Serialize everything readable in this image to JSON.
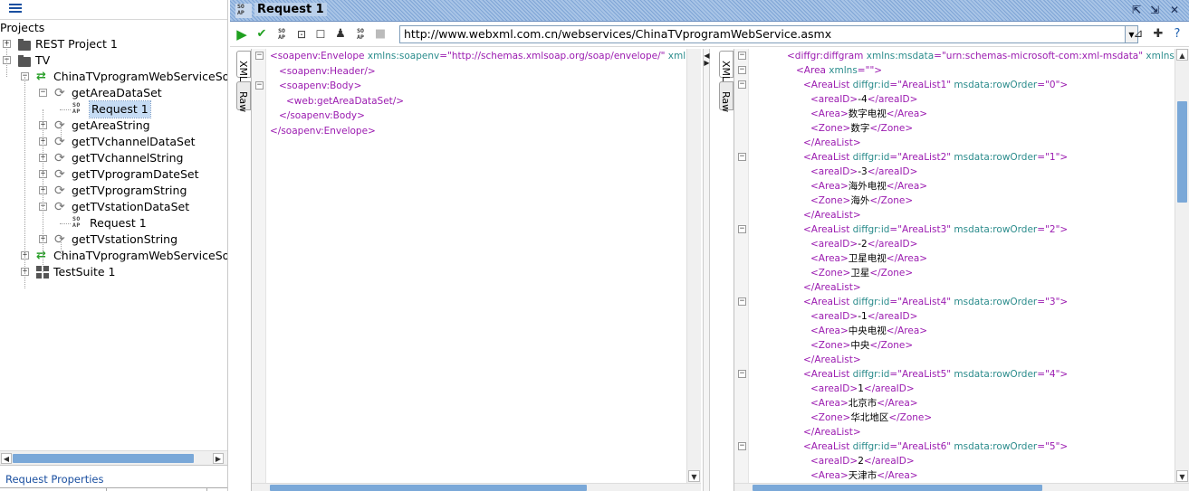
{
  "navigator": {
    "root_label": "Projects",
    "tree": [
      {
        "label": "REST Project 1",
        "icon": "folder-icon",
        "level": 0,
        "expander": "+"
      },
      {
        "label": "TV",
        "icon": "folder-icon",
        "level": 0,
        "expander": "-"
      },
      {
        "label": "ChinaTVprogramWebServiceSoa",
        "icon": "interface-icon",
        "level": 1,
        "expander": "-"
      },
      {
        "label": "getAreaDataSet",
        "icon": "operation-icon",
        "level": 2,
        "expander": "-"
      },
      {
        "label": "Request 1",
        "icon": "soap-request-icon",
        "level": 3,
        "expander": "",
        "selected": true
      },
      {
        "label": "getAreaString",
        "icon": "operation-icon",
        "level": 2,
        "expander": "+"
      },
      {
        "label": "getTVchannelDataSet",
        "icon": "operation-icon",
        "level": 2,
        "expander": "+"
      },
      {
        "label": "getTVchannelString",
        "icon": "operation-icon",
        "level": 2,
        "expander": "+"
      },
      {
        "label": "getTVprogramDateSet",
        "icon": "operation-icon",
        "level": 2,
        "expander": "+"
      },
      {
        "label": "getTVprogramString",
        "icon": "operation-icon",
        "level": 2,
        "expander": "+"
      },
      {
        "label": "getTVstationDataSet",
        "icon": "operation-icon",
        "level": 2,
        "expander": "-"
      },
      {
        "label": "Request 1",
        "icon": "soap-request-icon",
        "level": 3,
        "expander": ""
      },
      {
        "label": "getTVstationString",
        "icon": "operation-icon",
        "level": 2,
        "expander": "+"
      },
      {
        "label": "ChinaTVprogramWebServiceSoa",
        "icon": "interface-icon",
        "level": 1,
        "expander": "+"
      },
      {
        "label": "TestSuite 1",
        "icon": "test-suite-icon",
        "level": 1,
        "expander": "+"
      }
    ],
    "properties_title": "Request Properties"
  },
  "request_window": {
    "title": "Request 1",
    "endpoint": "http://www.webxml.com.cn/webservices/ChinaTVprogramWebService.asmx"
  },
  "tabs": {
    "xml": "XML",
    "raw": "Raw"
  },
  "request_xml": [
    [
      [
        "t",
        "<soapenv:Envelope"
      ],
      [
        "a",
        " xmlns:soapenv"
      ],
      [
        "t",
        "="
      ],
      [
        "v",
        "\"http://schemas.xmlsoap.org/soap/envelope/\""
      ],
      [
        "a",
        " xmlns:web"
      ],
      [
        "t",
        "=\""
      ]
    ],
    [
      [
        "t",
        "<soapenv:Header/>"
      ]
    ],
    [
      [
        "t",
        "<soapenv:Body>"
      ]
    ],
    [
      [
        "t",
        "<web:getAreaDataSet/>"
      ]
    ],
    [
      [
        "t",
        "</soapenv:Body>"
      ]
    ],
    [
      [
        "t",
        "</soapenv:Envelope>"
      ]
    ]
  ],
  "response_xml": [
    [
      [
        "t",
        "<diffgr:diffgram"
      ],
      [
        "a",
        " xmlns:msdata"
      ],
      [
        "t",
        "="
      ],
      [
        "v",
        "\"urn:schemas-microsoft-com:xml-msdata\""
      ],
      [
        "a",
        " xmlns:diffgr"
      ],
      [
        "t",
        "=\"u"
      ]
    ],
    [
      [
        "t",
        "<Area"
      ],
      [
        "a",
        " xmlns"
      ],
      [
        "t",
        "="
      ],
      [
        "v",
        "\"\""
      ],
      [
        "t",
        ">"
      ]
    ],
    [
      [
        "t",
        "<AreaList"
      ],
      [
        "a",
        " diffgr:id"
      ],
      [
        "t",
        "="
      ],
      [
        "v",
        "\"AreaList1\""
      ],
      [
        "a",
        " msdata:rowOrder"
      ],
      [
        "t",
        "="
      ],
      [
        "v",
        "\"0\""
      ],
      [
        "t",
        ">"
      ]
    ],
    [
      [
        "t",
        "<areaID>"
      ],
      [
        "x",
        "-4"
      ],
      [
        "t",
        "</areaID>"
      ]
    ],
    [
      [
        "t",
        "<Area>"
      ],
      [
        "x",
        "数字电视"
      ],
      [
        "t",
        "</Area>"
      ]
    ],
    [
      [
        "t",
        "<Zone>"
      ],
      [
        "x",
        "数字"
      ],
      [
        "t",
        "</Zone>"
      ]
    ],
    [
      [
        "t",
        "</AreaList>"
      ]
    ],
    [
      [
        "t",
        "<AreaList"
      ],
      [
        "a",
        " diffgr:id"
      ],
      [
        "t",
        "="
      ],
      [
        "v",
        "\"AreaList2\""
      ],
      [
        "a",
        " msdata:rowOrder"
      ],
      [
        "t",
        "="
      ],
      [
        "v",
        "\"1\""
      ],
      [
        "t",
        ">"
      ]
    ],
    [
      [
        "t",
        "<areaID>"
      ],
      [
        "x",
        "-3"
      ],
      [
        "t",
        "</areaID>"
      ]
    ],
    [
      [
        "t",
        "<Area>"
      ],
      [
        "x",
        "海外电视"
      ],
      [
        "t",
        "</Area>"
      ]
    ],
    [
      [
        "t",
        "<Zone>"
      ],
      [
        "x",
        "海外"
      ],
      [
        "t",
        "</Zone>"
      ]
    ],
    [
      [
        "t",
        "</AreaList>"
      ]
    ],
    [
      [
        "t",
        "<AreaList"
      ],
      [
        "a",
        " diffgr:id"
      ],
      [
        "t",
        "="
      ],
      [
        "v",
        "\"AreaList3\""
      ],
      [
        "a",
        " msdata:rowOrder"
      ],
      [
        "t",
        "="
      ],
      [
        "v",
        "\"2\""
      ],
      [
        "t",
        ">"
      ]
    ],
    [
      [
        "t",
        "<areaID>"
      ],
      [
        "x",
        "-2"
      ],
      [
        "t",
        "</areaID>"
      ]
    ],
    [
      [
        "t",
        "<Area>"
      ],
      [
        "x",
        "卫星电视"
      ],
      [
        "t",
        "</Area>"
      ]
    ],
    [
      [
        "t",
        "<Zone>"
      ],
      [
        "x",
        "卫星"
      ],
      [
        "t",
        "</Zone>"
      ]
    ],
    [
      [
        "t",
        "</AreaList>"
      ]
    ],
    [
      [
        "t",
        "<AreaList"
      ],
      [
        "a",
        " diffgr:id"
      ],
      [
        "t",
        "="
      ],
      [
        "v",
        "\"AreaList4\""
      ],
      [
        "a",
        " msdata:rowOrder"
      ],
      [
        "t",
        "="
      ],
      [
        "v",
        "\"3\""
      ],
      [
        "t",
        ">"
      ]
    ],
    [
      [
        "t",
        "<areaID>"
      ],
      [
        "x",
        "-1"
      ],
      [
        "t",
        "</areaID>"
      ]
    ],
    [
      [
        "t",
        "<Area>"
      ],
      [
        "x",
        "中央电视"
      ],
      [
        "t",
        "</Area>"
      ]
    ],
    [
      [
        "t",
        "<Zone>"
      ],
      [
        "x",
        "中央"
      ],
      [
        "t",
        "</Zone>"
      ]
    ],
    [
      [
        "t",
        "</AreaList>"
      ]
    ],
    [
      [
        "t",
        "<AreaList"
      ],
      [
        "a",
        " diffgr:id"
      ],
      [
        "t",
        "="
      ],
      [
        "v",
        "\"AreaList5\""
      ],
      [
        "a",
        " msdata:rowOrder"
      ],
      [
        "t",
        "="
      ],
      [
        "v",
        "\"4\""
      ],
      [
        "t",
        ">"
      ]
    ],
    [
      [
        "t",
        "<areaID>"
      ],
      [
        "x",
        "1"
      ],
      [
        "t",
        "</areaID>"
      ]
    ],
    [
      [
        "t",
        "<Area>"
      ],
      [
        "x",
        "北京市"
      ],
      [
        "t",
        "</Area>"
      ]
    ],
    [
      [
        "t",
        "<Zone>"
      ],
      [
        "x",
        "华北地区"
      ],
      [
        "t",
        "</Zone>"
      ]
    ],
    [
      [
        "t",
        "</AreaList>"
      ]
    ],
    [
      [
        "t",
        "<AreaList"
      ],
      [
        "a",
        " diffgr:id"
      ],
      [
        "t",
        "="
      ],
      [
        "v",
        "\"AreaList6\""
      ],
      [
        "a",
        " msdata:rowOrder"
      ],
      [
        "t",
        "="
      ],
      [
        "v",
        "\"5\""
      ],
      [
        "t",
        ">"
      ]
    ],
    [
      [
        "t",
        "<areaID>"
      ],
      [
        "x",
        "2"
      ],
      [
        "t",
        "</areaID>"
      ]
    ],
    [
      [
        "t",
        "<Area>"
      ],
      [
        "x",
        "天津市"
      ],
      [
        "t",
        "</Area>"
      ]
    ]
  ],
  "colors": {
    "tag": "#9b1bb0",
    "attribute": "#2b8c8c",
    "text": "#000000",
    "selection": "#c6dcf4",
    "scroll_thumb": "#7aa8d8",
    "run_green": "#1fa01f"
  }
}
